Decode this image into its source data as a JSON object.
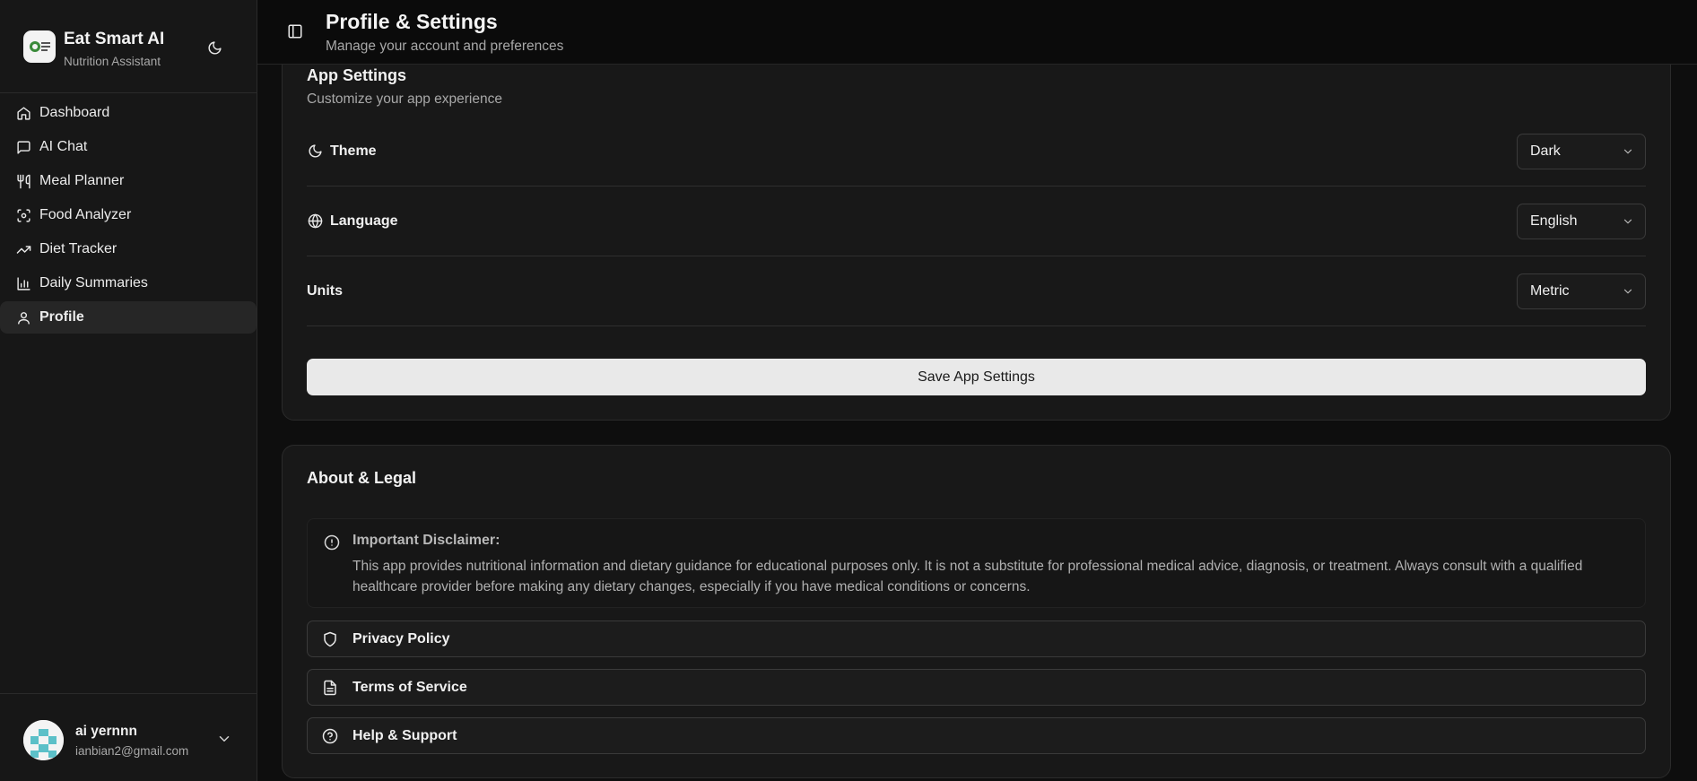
{
  "brand": {
    "name": "Eat Smart AI",
    "subtitle": "Nutrition Assistant",
    "logo_text": "EAT SMART AI"
  },
  "nav": {
    "items": [
      {
        "label": "Dashboard",
        "icon": "home-icon"
      },
      {
        "label": "AI Chat",
        "icon": "chat-icon"
      },
      {
        "label": "Meal Planner",
        "icon": "utensils-icon"
      },
      {
        "label": "Food Analyzer",
        "icon": "scan-icon"
      },
      {
        "label": "Diet Tracker",
        "icon": "trending-up-icon"
      },
      {
        "label": "Daily Summaries",
        "icon": "bar-chart-icon"
      },
      {
        "label": "Profile",
        "icon": "user-icon"
      }
    ],
    "active": "Profile"
  },
  "user": {
    "name": "ai yernnn",
    "email": "ianbian2@gmail.com"
  },
  "header": {
    "title": "Profile & Settings",
    "subtitle": "Manage your account and preferences"
  },
  "app_settings": {
    "title": "App Settings",
    "description": "Customize your app experience",
    "rows": [
      {
        "label": "Theme",
        "value": "Dark",
        "icon": "moon-icon"
      },
      {
        "label": "Language",
        "value": "English",
        "icon": "globe-icon"
      },
      {
        "label": "Units",
        "value": "Metric",
        "icon": ""
      }
    ],
    "save_label": "Save App Settings"
  },
  "about": {
    "title": "About & Legal",
    "disclaimer_title": "Important Disclaimer:",
    "disclaimer_text": "This app provides nutritional information and dietary guidance for educational purposes only. It is not a substitute for professional medical advice, diagnosis, or treatment. Always consult with a qualified healthcare provider before making any dietary changes, especially if you have medical conditions or concerns.",
    "links": [
      {
        "label": "Privacy Policy",
        "icon": "shield-icon"
      },
      {
        "label": "Terms of Service",
        "icon": "file-text-icon"
      },
      {
        "label": "Help & Support",
        "icon": "help-circle-icon"
      }
    ]
  },
  "colors": {
    "background": "#0e0e0e",
    "sidebar": "#171717",
    "card": "#181818",
    "button": "#e9e9e9",
    "active_nav": "#262626"
  }
}
